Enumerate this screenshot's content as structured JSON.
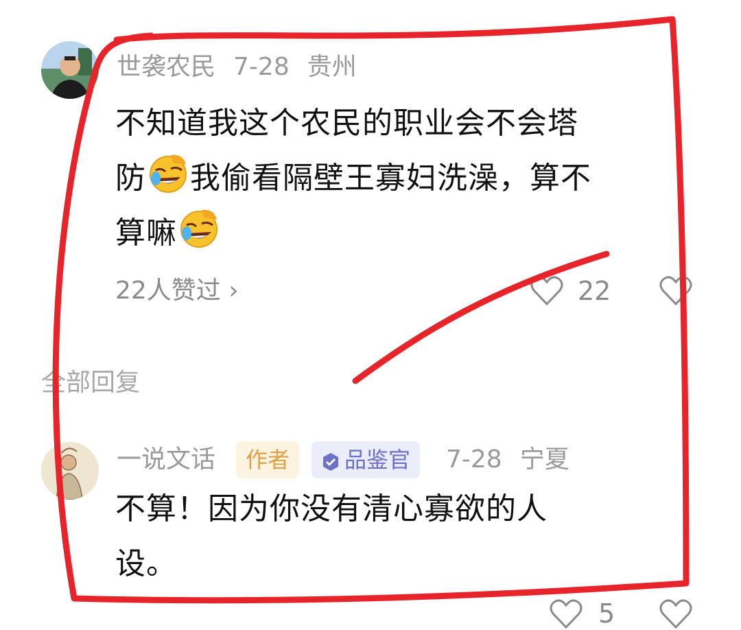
{
  "comment": {
    "username": "世袭农民",
    "date": "7-28",
    "location": "贵州",
    "text_line1": "不知道我这个农民的职业会不会塔",
    "text_line2_a": "防",
    "text_line2_b": "我偷看隔壁王寡妇洗澡，算不",
    "text_line3": "算嘛",
    "likes_summary": "22人赞过 ›",
    "like_count": "22"
  },
  "section": {
    "title": "全部回复"
  },
  "reply": {
    "username": "一说文话",
    "author_badge": "作者",
    "judge_badge": "品鉴官",
    "date": "7-28",
    "location": "宁夏",
    "text_line1": "不算！因为你没有清心寡欲的人",
    "text_line2": "设。",
    "partial_bottom_count": "5"
  },
  "icons": {
    "emoji": "rolling-on-floor-laughing-emoji",
    "like": "heart-outline-icon",
    "verified": "verified-check-icon"
  },
  "colors": {
    "red_annotation": "#e8242b",
    "meta_gray": "#9a9a9a",
    "author_badge_bg": "#fdf3e1",
    "author_badge_text": "#e0a046",
    "judge_badge_bg": "#ecedfb",
    "judge_badge_text": "#6b70c9"
  }
}
